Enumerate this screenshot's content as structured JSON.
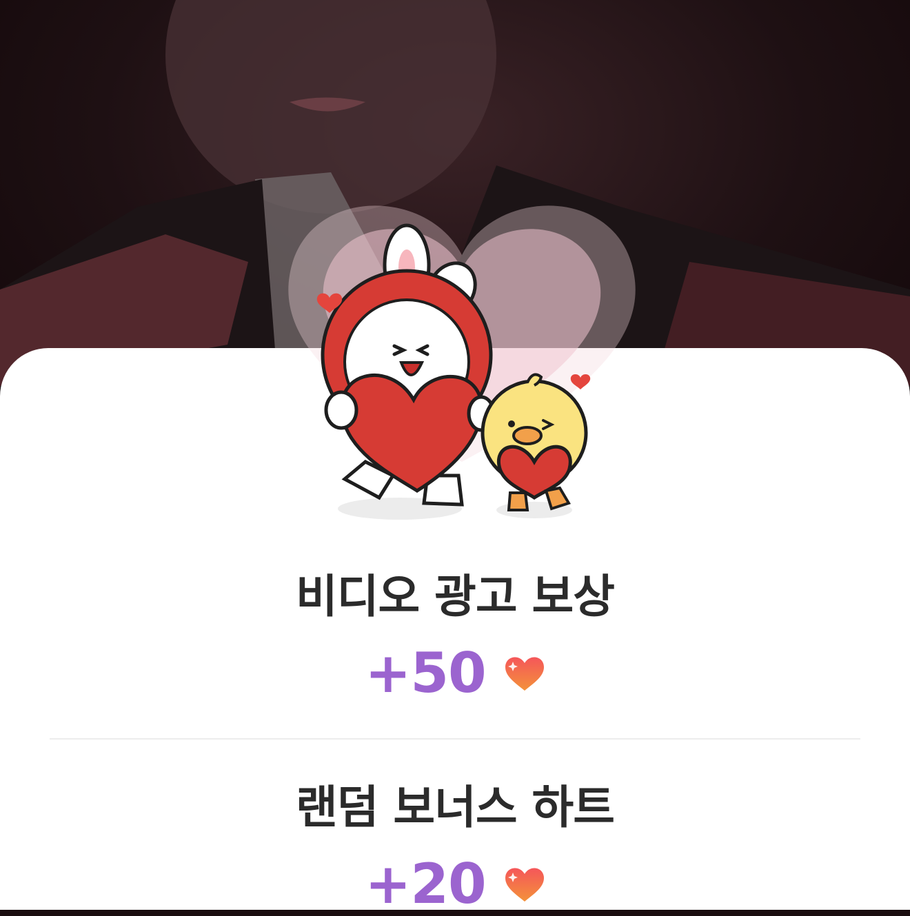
{
  "header": {
    "background": "profile-photo"
  },
  "mascot": {
    "icon": "bunny-chick-heart-sticker"
  },
  "rewards": [
    {
      "title": "비디오 광고 보상",
      "amount": "+50",
      "icon": "heart-icon"
    },
    {
      "title": "랜덤 보너스 하트",
      "amount": "+20",
      "icon": "heart-icon"
    }
  ],
  "colors": {
    "amount": "#9b64cf",
    "heart": "#f06a3c",
    "title": "#2b2b2b"
  }
}
